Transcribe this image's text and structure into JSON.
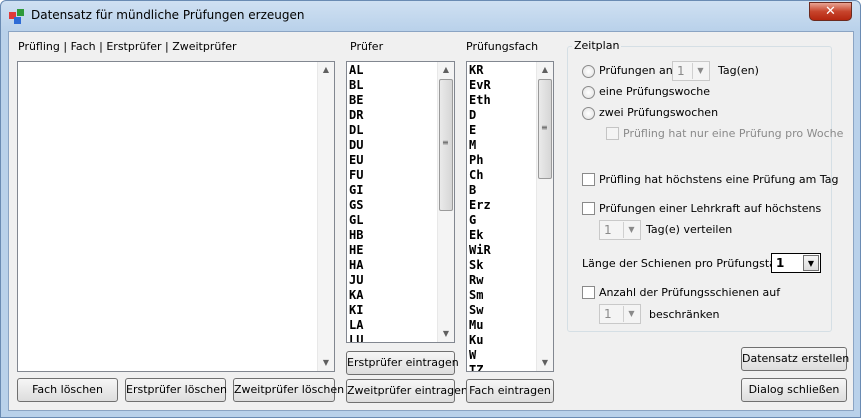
{
  "window": {
    "title": "Datensatz für mündliche Prüfungen erzeugen",
    "close_label": "✕"
  },
  "headers": {
    "main_list": "Prüfling | Fach | Erstprüfer | Zweitprüfer",
    "pruefer": "Prüfer",
    "fach": "Prüfungsfach"
  },
  "pruefer_items": [
    "AL",
    "BL",
    "BE",
    "DR",
    "DL",
    "DU",
    "EU",
    "FU",
    "GI",
    "GS",
    "GL",
    "HB",
    "HE",
    "HA",
    "JU",
    "KA",
    "KI",
    "LA",
    "LU"
  ],
  "fach_items": [
    "KR",
    "EvR",
    "Eth",
    "D",
    "E",
    "M",
    "Ph",
    "Ch",
    "B",
    "Erz",
    "G",
    "Ek",
    "WiR",
    "Sk",
    "Rw",
    "Sm",
    "Sw",
    "Mu",
    "Ku",
    "W",
    "TZ"
  ],
  "buttons": {
    "fach_loeschen": "Fach löschen",
    "erstpruefer_loeschen": "Erstprüfer löschen",
    "zweitpruefer_loeschen": "Zweitprüfer löschen",
    "erstpruefer_eintragen": "Erstprüfer eintragen",
    "zweitpruefer_eintragen": "Zweitprüfer eintragen",
    "fach_eintragen": "Fach eintragen",
    "datensatz_erstellen": "Datensatz erstellen",
    "dialog_schliessen": "Dialog schließen"
  },
  "zeitplan": {
    "title": "Zeitplan",
    "radio_tage_label": "Prüfungen an",
    "radio_tage_value": "1",
    "radio_tage_suffix": "Tag(en)",
    "radio_eine_woche": "eine Prüfungswoche",
    "radio_zwei_wochen": "zwei Prüfungswochen",
    "check_eine_pro_woche": "Prüfling hat nur eine Prüfung pro Woche",
    "check_hoechstens_tag": "Prüfling hat höchstens eine Prüfung am Tag",
    "check_lehrkraft": "Prüfungen einer Lehrkraft auf höchstens",
    "lehrkraft_value": "1",
    "lehrkraft_suffix": "Tag(e) verteilen",
    "schienen_label": "Länge der Schienen pro Prüfungstag:",
    "schienen_value": "1",
    "check_anzahl": "Anzahl der Prüfungsschienen auf",
    "anzahl_value": "1",
    "anzahl_suffix": "beschränken"
  }
}
